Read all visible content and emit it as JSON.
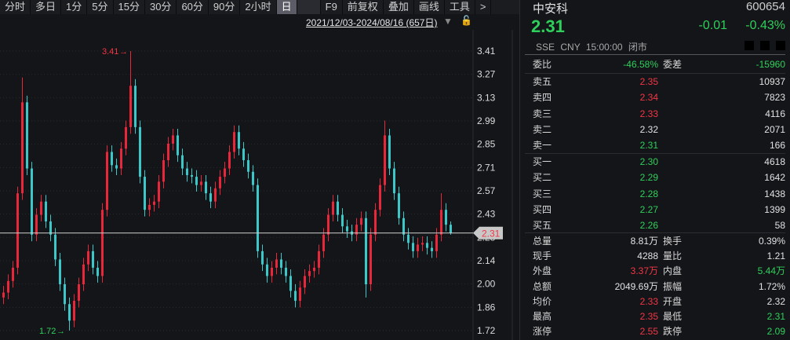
{
  "toolbar": {
    "items": [
      "分时",
      "多日",
      "1分",
      "5分",
      "15分",
      "30分",
      "60分",
      "90分",
      "2小时",
      "日"
    ],
    "selected": "日",
    "tools": [
      "F9",
      "前复权",
      "叠加",
      "画线",
      "工具",
      ">"
    ]
  },
  "range": {
    "label": "2021/12/03-2024/08/16 (657日)"
  },
  "quote": {
    "name": "中安科",
    "code": "600654",
    "price": "2.31",
    "change": "-0.01",
    "change_pct": "-0.43%",
    "exchange": "SSE",
    "currency": "CNY",
    "time": "15:00:00",
    "status": "闭市",
    "wei_bi_label": "委比",
    "wei_bi": "-46.58%",
    "wei_cha_label": "委差",
    "wei_cha": "-15960",
    "asks": [
      {
        "label": "卖五",
        "price": "2.35",
        "vol": "10937",
        "color": "r"
      },
      {
        "label": "卖四",
        "price": "2.34",
        "vol": "7823",
        "color": "r"
      },
      {
        "label": "卖三",
        "price": "2.33",
        "vol": "4116",
        "color": "r"
      },
      {
        "label": "卖二",
        "price": "2.32",
        "vol": "2071",
        "color": "w"
      },
      {
        "label": "卖一",
        "price": "2.31",
        "vol": "166",
        "color": "g"
      }
    ],
    "bids": [
      {
        "label": "买一",
        "price": "2.30",
        "vol": "4618",
        "color": "g"
      },
      {
        "label": "买二",
        "price": "2.29",
        "vol": "1642",
        "color": "g"
      },
      {
        "label": "买三",
        "price": "2.28",
        "vol": "1438",
        "color": "g"
      },
      {
        "label": "买四",
        "price": "2.27",
        "vol": "1399",
        "color": "g"
      },
      {
        "label": "买五",
        "price": "2.26",
        "vol": "58",
        "color": "g"
      }
    ],
    "stats": [
      {
        "l1": "总量",
        "v1": "8.81万",
        "c1": "w",
        "l2": "换手",
        "v2": "0.39%",
        "c2": "w"
      },
      {
        "l1": "现手",
        "v1": "4288",
        "c1": "w",
        "l2": "量比",
        "v2": "1.21",
        "c2": "w"
      },
      {
        "l1": "外盘",
        "v1": "3.37万",
        "c1": "r",
        "l2": "内盘",
        "v2": "5.44万",
        "c2": "g"
      },
      {
        "l1": "总额",
        "v1": "2049.69万",
        "c1": "w",
        "l2": "振幅",
        "v2": "1.72%",
        "c2": "w"
      },
      {
        "l1": "均价",
        "v1": "2.33",
        "c1": "r",
        "l2": "开盘",
        "v2": "2.32",
        "c2": "w"
      },
      {
        "l1": "最高",
        "v1": "2.35",
        "c1": "r",
        "l2": "最低",
        "v2": "2.31",
        "c2": "g"
      },
      {
        "l1": "涨停",
        "v1": "2.55",
        "c1": "r",
        "l2": "跌停",
        "v2": "2.09",
        "c2": "g"
      }
    ]
  },
  "colors": {
    "up": "#e8283a",
    "down": "#3cc8c8",
    "up_text": "#f23645",
    "down_text": "#2fcf5b"
  },
  "chart_data": {
    "type": "candlestick",
    "ylim": [
      1.72,
      3.41
    ],
    "yticks": [
      "3.41",
      "3.27",
      "3.13",
      "2.99",
      "2.85",
      "2.71",
      "2.57",
      "2.43",
      "2.28",
      "2.14",
      "2.00",
      "1.86",
      "1.72"
    ],
    "last_price": "2.31",
    "max_label": "3.41",
    "min_label": "1.72",
    "ohlc": [
      [
        1.92,
        1.99,
        1.88,
        1.95
      ],
      [
        1.95,
        2.06,
        1.91,
        2.02
      ],
      [
        2.02,
        2.14,
        1.98,
        2.1
      ],
      [
        2.1,
        2.59,
        2.06,
        2.55
      ],
      [
        2.55,
        3.25,
        2.51,
        3.1
      ],
      [
        3.1,
        3.14,
        2.66,
        2.7
      ],
      [
        2.7,
        2.74,
        2.26,
        2.3
      ],
      [
        2.3,
        2.46,
        2.26,
        2.42
      ],
      [
        2.42,
        2.54,
        2.38,
        2.5
      ],
      [
        2.5,
        2.54,
        2.34,
        2.38
      ],
      [
        2.38,
        2.42,
        2.26,
        2.3
      ],
      [
        2.3,
        2.34,
        2.11,
        2.15
      ],
      [
        2.15,
        2.19,
        1.96,
        2.0
      ],
      [
        2.0,
        2.04,
        1.84,
        1.88
      ],
      [
        1.88,
        1.92,
        1.72,
        1.78
      ],
      [
        1.78,
        1.94,
        1.74,
        1.9
      ],
      [
        1.9,
        2.04,
        1.86,
        2.0
      ],
      [
        2.0,
        2.16,
        1.96,
        2.12
      ],
      [
        2.12,
        2.24,
        2.08,
        2.2
      ],
      [
        2.2,
        2.24,
        2.06,
        2.1
      ],
      [
        2.1,
        2.14,
        2.01,
        2.05
      ],
      [
        2.05,
        2.49,
        2.01,
        2.45
      ],
      [
        2.45,
        2.84,
        2.41,
        2.8
      ],
      [
        2.8,
        2.84,
        2.68,
        2.72
      ],
      [
        2.72,
        2.76,
        2.66,
        2.7
      ],
      [
        2.7,
        2.86,
        2.66,
        2.82
      ],
      [
        2.82,
        2.99,
        2.78,
        2.95
      ],
      [
        2.95,
        3.41,
        2.91,
        3.2
      ],
      [
        3.2,
        3.24,
        2.91,
        2.95
      ],
      [
        2.95,
        2.99,
        2.61,
        2.65
      ],
      [
        2.65,
        2.69,
        2.41,
        2.45
      ],
      [
        2.45,
        2.52,
        2.41,
        2.48
      ],
      [
        2.48,
        2.54,
        2.44,
        2.5
      ],
      [
        2.5,
        2.66,
        2.46,
        2.62
      ],
      [
        2.62,
        2.79,
        2.58,
        2.75
      ],
      [
        2.75,
        2.89,
        2.71,
        2.85
      ],
      [
        2.85,
        2.94,
        2.81,
        2.9
      ],
      [
        2.9,
        2.94,
        2.74,
        2.78
      ],
      [
        2.78,
        2.82,
        2.66,
        2.7
      ],
      [
        2.7,
        2.74,
        2.62,
        2.66
      ],
      [
        2.66,
        2.7,
        2.61,
        2.65
      ],
      [
        2.65,
        2.69,
        2.56,
        2.6
      ],
      [
        2.6,
        2.66,
        2.56,
        2.62
      ],
      [
        2.62,
        2.66,
        2.51,
        2.55
      ],
      [
        2.55,
        2.59,
        2.46,
        2.5
      ],
      [
        2.5,
        2.62,
        2.46,
        2.58
      ],
      [
        2.58,
        2.69,
        2.54,
        2.65
      ],
      [
        2.65,
        2.74,
        2.61,
        2.7
      ],
      [
        2.7,
        2.84,
        2.66,
        2.8
      ],
      [
        2.8,
        2.96,
        2.76,
        2.92
      ],
      [
        2.92,
        2.96,
        2.78,
        2.82
      ],
      [
        2.82,
        2.86,
        2.71,
        2.75
      ],
      [
        2.75,
        2.79,
        2.64,
        2.68
      ],
      [
        2.68,
        2.72,
        2.56,
        2.6
      ],
      [
        2.6,
        2.64,
        2.16,
        2.2
      ],
      [
        2.2,
        2.24,
        2.08,
        2.12
      ],
      [
        2.12,
        2.16,
        2.01,
        2.05
      ],
      [
        2.05,
        2.14,
        2.01,
        2.1
      ],
      [
        2.1,
        2.19,
        2.06,
        2.15
      ],
      [
        2.15,
        2.19,
        2.06,
        2.1
      ],
      [
        2.1,
        2.14,
        2.01,
        2.05
      ],
      [
        2.05,
        2.09,
        1.92,
        1.96
      ],
      [
        1.96,
        2.0,
        1.86,
        1.9
      ],
      [
        1.9,
        2.02,
        1.86,
        1.98
      ],
      [
        1.98,
        2.09,
        1.94,
        2.05
      ],
      [
        2.05,
        2.12,
        2.01,
        2.08
      ],
      [
        2.08,
        2.14,
        2.04,
        2.1
      ],
      [
        2.1,
        2.24,
        2.06,
        2.2
      ],
      [
        2.2,
        2.34,
        2.16,
        2.3
      ],
      [
        2.3,
        2.46,
        2.26,
        2.42
      ],
      [
        2.42,
        2.54,
        2.38,
        2.5
      ],
      [
        2.5,
        2.54,
        2.38,
        2.42
      ],
      [
        2.42,
        2.46,
        2.31,
        2.35
      ],
      [
        2.35,
        2.39,
        2.28,
        2.32
      ],
      [
        2.32,
        2.36,
        2.26,
        2.3
      ],
      [
        2.3,
        2.4,
        2.26,
        2.36
      ],
      [
        2.36,
        2.44,
        2.32,
        2.4
      ],
      [
        2.4,
        2.44,
        1.92,
        2.0
      ],
      [
        2.0,
        2.34,
        1.96,
        2.3
      ],
      [
        2.3,
        2.49,
        2.26,
        2.45
      ],
      [
        2.45,
        2.64,
        2.41,
        2.6
      ],
      [
        2.6,
        2.99,
        2.56,
        2.9
      ],
      [
        2.9,
        2.94,
        2.66,
        2.7
      ],
      [
        2.7,
        2.74,
        2.51,
        2.55
      ],
      [
        2.55,
        2.59,
        2.36,
        2.4
      ],
      [
        2.4,
        2.44,
        2.26,
        2.3
      ],
      [
        2.3,
        2.34,
        2.21,
        2.25
      ],
      [
        2.25,
        2.29,
        2.16,
        2.2
      ],
      [
        2.2,
        2.28,
        2.16,
        2.24
      ],
      [
        2.24,
        2.29,
        2.2,
        2.25
      ],
      [
        2.25,
        2.29,
        2.18,
        2.22
      ],
      [
        2.22,
        2.26,
        2.16,
        2.2
      ],
      [
        2.2,
        2.34,
        2.16,
        2.3
      ],
      [
        2.3,
        2.55,
        2.26,
        2.45
      ],
      [
        2.45,
        2.49,
        2.32,
        2.36
      ],
      [
        2.36,
        2.38,
        2.3,
        2.31
      ]
    ]
  }
}
